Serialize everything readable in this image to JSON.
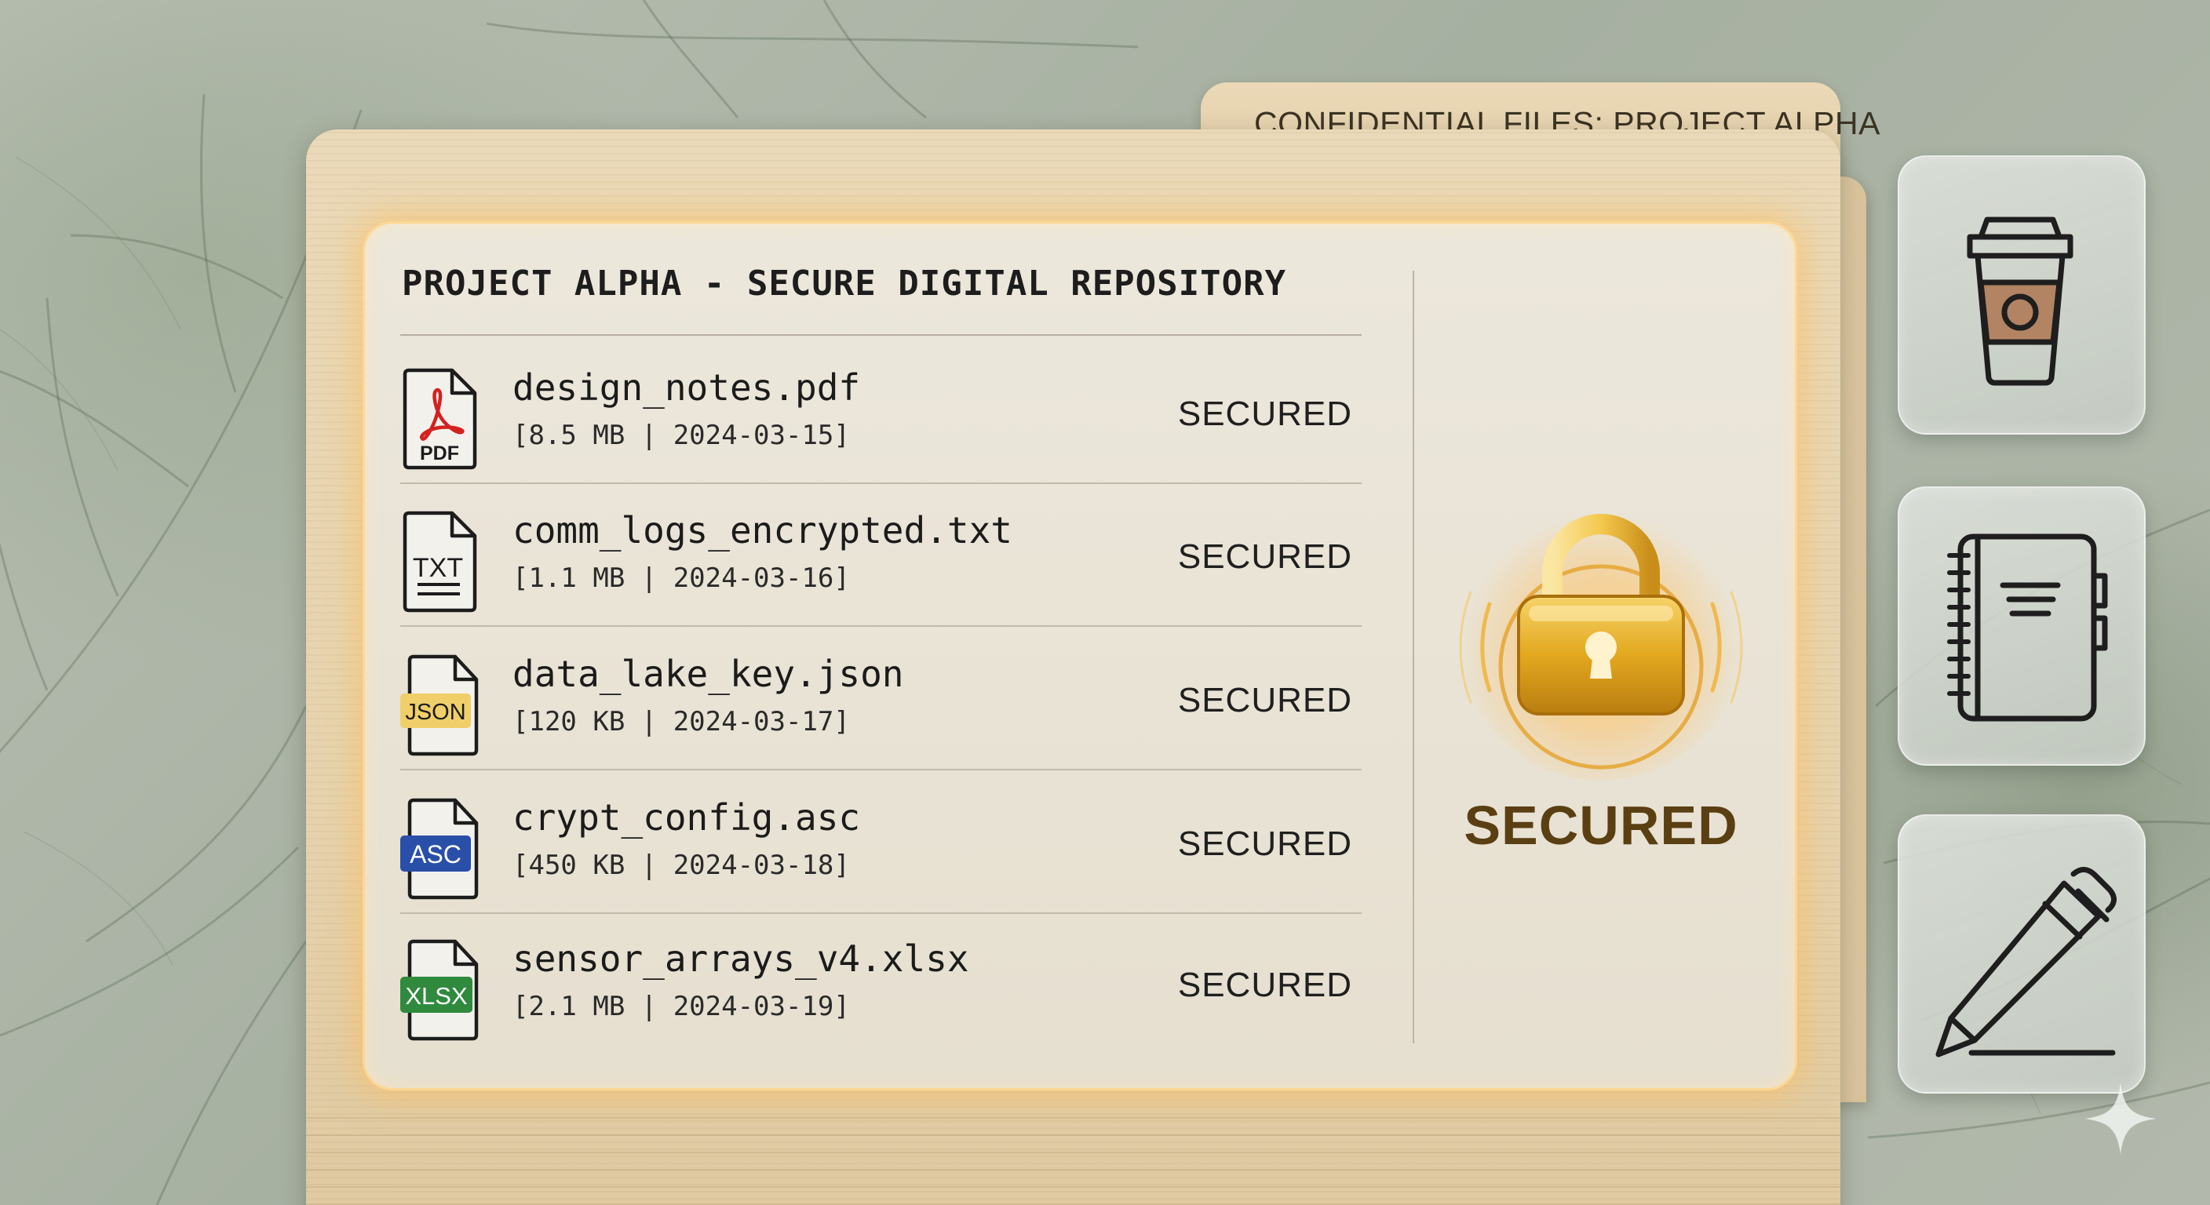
{
  "folder": {
    "tab_label": "CONFIDENTIAL FILES: PROJECT ALPHA"
  },
  "panel": {
    "title": "PROJECT ALPHA - SECURE DIGITAL REPOSITORY"
  },
  "files": [
    {
      "name": "design_notes.pdf",
      "meta": "[8.5 MB | 2024-03-15]",
      "status": "SECURED",
      "type_label": "PDF",
      "icon": "pdf-file-icon"
    },
    {
      "name": "comm_logs_encrypted.txt",
      "meta": "[1.1 MB | 2024-03-16]",
      "status": "SECURED",
      "type_label": "TXT",
      "icon": "txt-file-icon"
    },
    {
      "name": "data_lake_key.json",
      "meta": "[120 KB | 2024-03-17]",
      "status": "SECURED",
      "type_label": "JSON",
      "icon": "json-file-icon"
    },
    {
      "name": "crypt_config.asc",
      "meta": "[450 KB | 2024-03-18]",
      "status": "SECURED",
      "type_label": "ASC",
      "icon": "asc-file-icon"
    },
    {
      "name": "sensor_arrays_v4.xlsx",
      "meta": "[2.1 MB | 2024-03-19]",
      "status": "SECURED",
      "type_label": "XLSX",
      "icon": "xlsx-file-icon"
    }
  ],
  "lock": {
    "label": "SECURED",
    "icon": "padlock-icon"
  },
  "tools": [
    {
      "name": "coffee-cup-icon"
    },
    {
      "name": "notebook-icon"
    },
    {
      "name": "pen-icon"
    }
  ],
  "colors": {
    "pdf": "#d4211f",
    "json_badge": "#f0cf6a",
    "asc_badge": "#2a4fa8",
    "xlsx_badge": "#2f8a3e",
    "lock_gold": "#e3a81f",
    "glow": "#ffbe5a",
    "folder": "#e6d3ae"
  }
}
